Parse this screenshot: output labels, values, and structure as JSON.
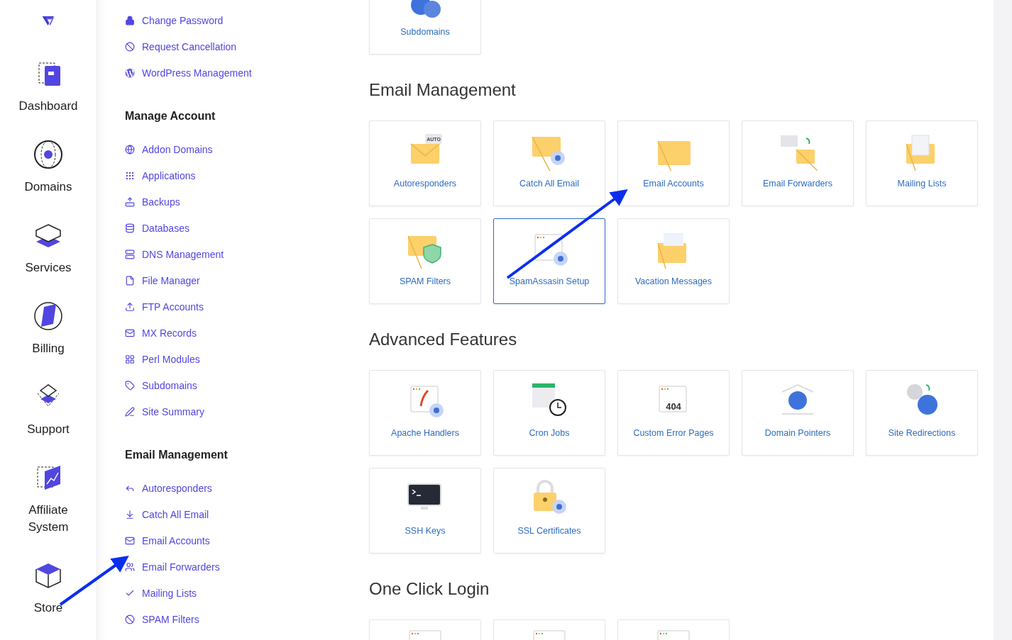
{
  "rail": {
    "items": [
      {
        "label": "Dashboard"
      },
      {
        "label": "Domains"
      },
      {
        "label": "Services"
      },
      {
        "label": "Billing"
      },
      {
        "label": "Support"
      },
      {
        "label": "Affiliate System"
      },
      {
        "label": "Store"
      }
    ]
  },
  "menu": {
    "sections": [
      {
        "links": [
          "Change Password",
          "Request Cancellation",
          "WordPress Management"
        ]
      },
      {
        "heading": "Manage Account",
        "links": [
          "Addon Domains",
          "Applications",
          "Backups",
          "Databases",
          "DNS Management",
          "File Manager",
          "FTP Accounts",
          "MX Records",
          "Perl Modules",
          "Subdomains",
          "Site Summary"
        ]
      },
      {
        "heading": "Email Management",
        "links": [
          "Autoresponders",
          "Catch All Email",
          "Email Accounts",
          "Email Forwarders",
          "Mailing Lists",
          "SPAM Filters"
        ]
      }
    ]
  },
  "content": {
    "sections": [
      {
        "cards": [
          {
            "label": "Subdomains",
            "selected": false
          }
        ]
      },
      {
        "heading": "Email Management",
        "cards": [
          {
            "label": "Autoresponders",
            "selected": false
          },
          {
            "label": "Catch All Email",
            "selected": false
          },
          {
            "label": "Email Accounts",
            "selected": false
          },
          {
            "label": "Email Forwarders",
            "selected": false
          },
          {
            "label": "Mailing Lists",
            "selected": false
          },
          {
            "label": "SPAM Filters",
            "selected": false
          },
          {
            "label": "SpamAssasin Setup",
            "selected": true
          },
          {
            "label": "Vacation Messages",
            "selected": false
          }
        ]
      },
      {
        "heading": "Advanced Features",
        "cards": [
          {
            "label": "Apache Handlers",
            "selected": false
          },
          {
            "label": "Cron Jobs",
            "selected": false
          },
          {
            "label": "Custom Error Pages",
            "selected": false
          },
          {
            "label": "Domain Pointers",
            "selected": false
          },
          {
            "label": "Site Redirections",
            "selected": false
          },
          {
            "label": "SSH Keys",
            "selected": false
          },
          {
            "label": "SSL Certificates",
            "selected": false
          }
        ]
      },
      {
        "heading": "One Click Login",
        "cards": [
          {
            "selected": false
          },
          {
            "selected": false
          },
          {
            "selected": false
          }
        ]
      }
    ]
  },
  "cards_404_text": "404",
  "auto_badge": "AUTO"
}
